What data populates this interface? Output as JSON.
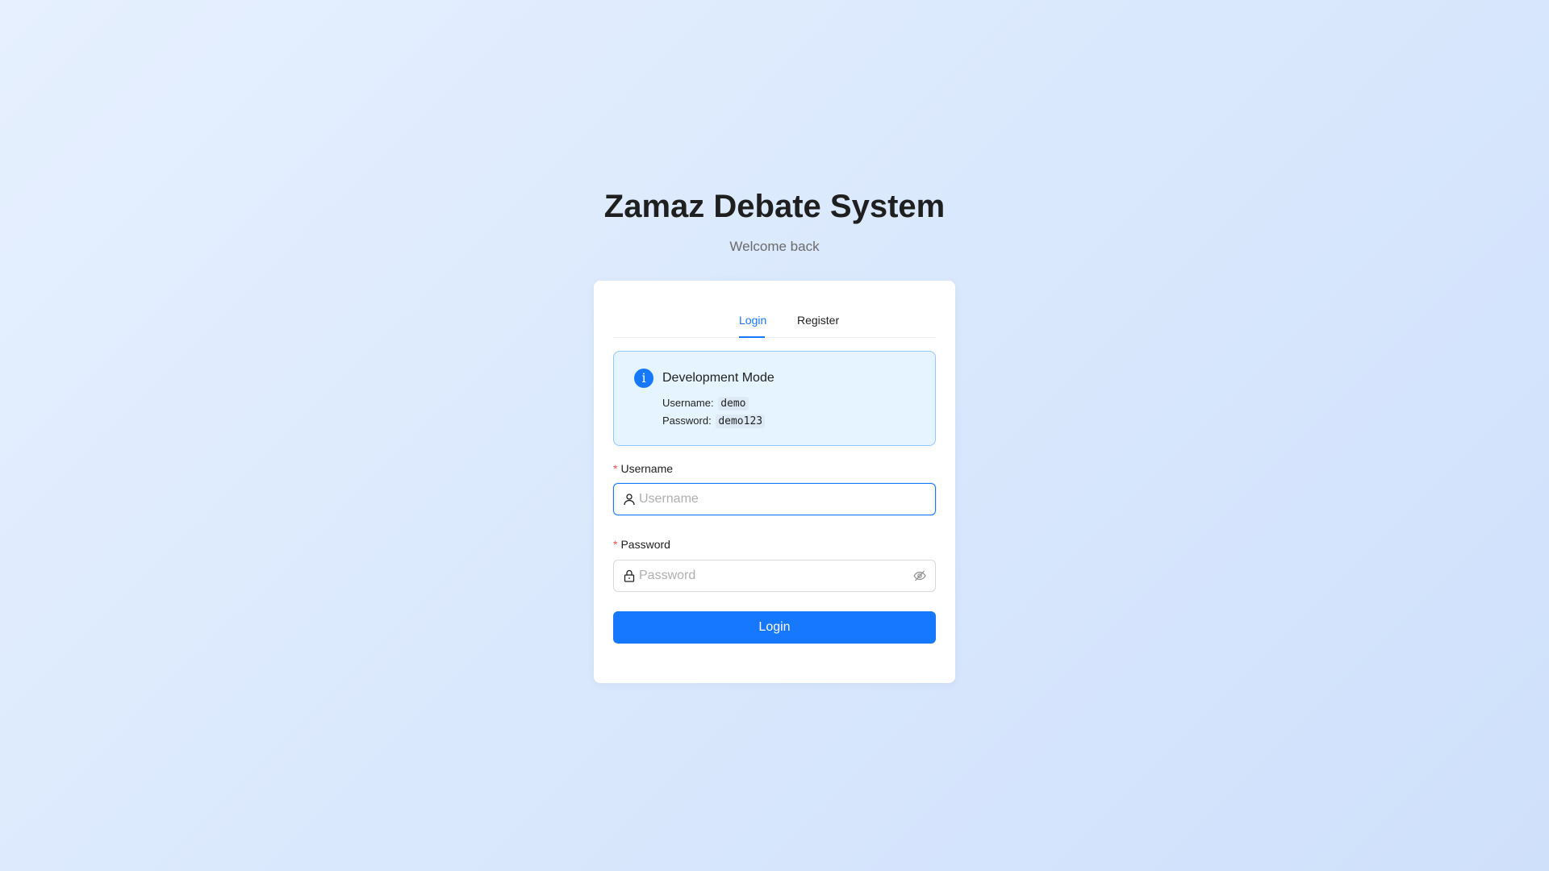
{
  "header": {
    "title": "Zamaz Debate System",
    "subtitle": "Welcome back"
  },
  "tabs": [
    {
      "label": "Login",
      "active": true
    },
    {
      "label": "Register",
      "active": false
    }
  ],
  "alert": {
    "icon": "info-icon",
    "icon_glyph": "i",
    "title": "Development Mode",
    "username_label": "Username:",
    "username_value": "demo",
    "password_label": "Password:",
    "password_value": "demo123"
  },
  "form": {
    "required_mark": "*",
    "username": {
      "label": "Username",
      "placeholder": "Username",
      "value": "",
      "icon": "user-icon"
    },
    "password": {
      "label": "Password",
      "placeholder": "Password",
      "value": "",
      "icon": "lock-icon",
      "toggle_icon": "eye-slash-icon"
    },
    "submit_label": "Login"
  },
  "colors": {
    "accent": "#1677ff",
    "alert_bg": "#e6f4ff",
    "alert_border": "#91caff",
    "required": "#ff4d4f"
  }
}
